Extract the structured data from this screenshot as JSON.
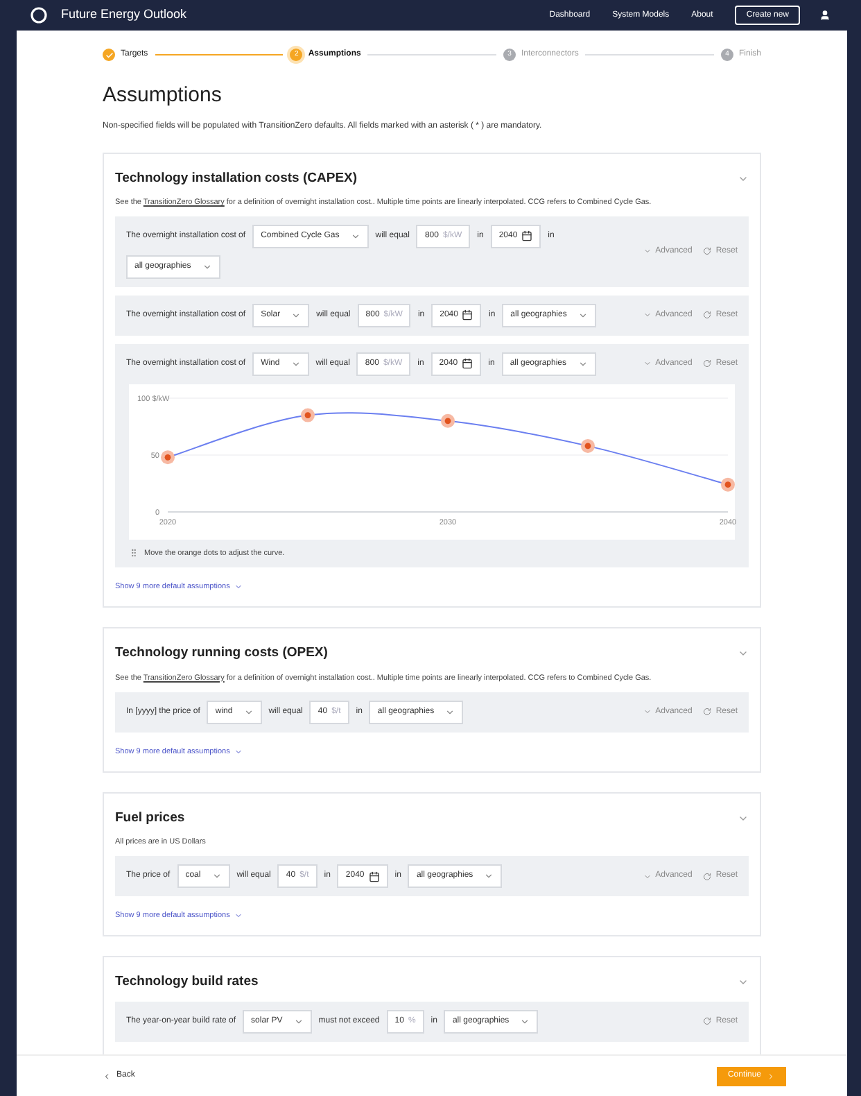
{
  "header": {
    "title": "Future Energy Outlook",
    "nav": [
      {
        "label": "Dashboard"
      },
      {
        "label": "System Models"
      },
      {
        "label": "About"
      }
    ],
    "create_button": "Create new"
  },
  "stepper": [
    {
      "label": "Targets",
      "completed": true,
      "selected": false
    },
    {
      "label": "Assumptions",
      "completed": false,
      "selected": true,
      "number": "2"
    },
    {
      "label": "Interconnectors",
      "completed": false,
      "selected": false,
      "number": "3"
    },
    {
      "label": "Finish",
      "completed": false,
      "selected": false,
      "number": "4"
    }
  ],
  "page": {
    "title": "Assumptions",
    "description": "Non-specified fields will be populated with TransitionZero defaults. All fields marked with an asterisk ( * ) are mandatory."
  },
  "sections": [
    {
      "title": "Technology installation costs (CAPEX)",
      "expanded": true,
      "description": {
        "before": "See the ",
        "link": "TransitionZero Glossary",
        "after": " for a definition of overnight installation cost.. Multiple time points are linearly interpolated. CCG refers to Combined Cycle Gas."
      },
      "rows": [
        {
          "parts": [
            {
              "kind": "text",
              "text": "The overnight installation cost of"
            },
            {
              "kind": "select",
              "value": "Combined Cycle Gas"
            },
            {
              "kind": "text",
              "text": "will equal"
            },
            {
              "kind": "number",
              "value": "800",
              "unit": "$/kW"
            },
            {
              "kind": "text",
              "text": "in"
            },
            {
              "kind": "year",
              "value": "2040"
            },
            {
              "kind": "text",
              "text": "in"
            },
            {
              "kind": "select",
              "value": "all geographies"
            }
          ],
          "advanced": "Advanced",
          "reset": "Reset"
        },
        {
          "parts": [
            {
              "kind": "text",
              "text": "The overnight installation cost of"
            },
            {
              "kind": "select",
              "value": "Solar"
            },
            {
              "kind": "text",
              "text": "will equal"
            },
            {
              "kind": "number",
              "value": "800",
              "unit": "$/kW"
            },
            {
              "kind": "text",
              "text": "in"
            },
            {
              "kind": "year",
              "value": "2040"
            },
            {
              "kind": "text",
              "text": "in"
            },
            {
              "kind": "select",
              "value": "all geographies"
            }
          ],
          "advanced": "Advanced",
          "reset": "Reset"
        },
        {
          "parts": [
            {
              "kind": "text",
              "text": "The overnight installation cost of"
            },
            {
              "kind": "select",
              "value": "Wind"
            },
            {
              "kind": "text",
              "text": "will equal"
            },
            {
              "kind": "number",
              "value": "800",
              "unit": "$/kW"
            },
            {
              "kind": "text",
              "text": "in"
            },
            {
              "kind": "year",
              "value": "2040"
            },
            {
              "kind": "text",
              "text": "in"
            },
            {
              "kind": "select",
              "value": "all geographies"
            }
          ],
          "advanced": "Advanced",
          "reset": "Reset",
          "chart_data": {
            "type": "line",
            "x": [
              2020,
              2025,
              2030,
              2035,
              2040
            ],
            "series": [
              {
                "color": "#6b7ff0",
                "marker": "circle",
                "values": [
                  48,
                  85,
                  80,
                  58,
                  24
                ]
              }
            ],
            "xlim": [
              2020,
              2040
            ],
            "ylim": [
              0,
              100
            ],
            "xticks": [
              2020,
              2030,
              2040
            ],
            "yticks": [
              0,
              50,
              {
                "value": 100,
                "label": "100 $/kW"
              }
            ]
          },
          "hint": "Move the orange dots to adjust the curve."
        }
      ],
      "show_more": "Show 9 more default assumptions"
    },
    {
      "title": "Technology running costs (OPEX)",
      "expanded": true,
      "description": {
        "before": "See the ",
        "link": "TransitionZero Glossary",
        "after": " for a definition of overnight installation cost.. Multiple time points are linearly interpolated. CCG refers to Combined Cycle Gas."
      },
      "rows": [
        {
          "parts": [
            {
              "kind": "text",
              "text": "In [yyyy] the price of"
            },
            {
              "kind": "select",
              "value": "wind"
            },
            {
              "kind": "text",
              "text": "will equal"
            },
            {
              "kind": "number",
              "value": "40",
              "unit": "$/t"
            },
            {
              "kind": "text",
              "text": "in"
            },
            {
              "kind": "select",
              "value": "all geographies"
            }
          ],
          "advanced": "Advanced",
          "reset": "Reset"
        }
      ],
      "show_more": "Show 9 more default assumptions"
    },
    {
      "title": "Fuel prices",
      "expanded": true,
      "description": {
        "before": "All prices are in US Dollars"
      },
      "rows": [
        {
          "parts": [
            {
              "kind": "text",
              "text": "The price of"
            },
            {
              "kind": "select",
              "value": "coal"
            },
            {
              "kind": "text",
              "text": "will equal"
            },
            {
              "kind": "number",
              "value": "40",
              "unit": "$/t"
            },
            {
              "kind": "text",
              "text": "in"
            },
            {
              "kind": "year",
              "value": "2040"
            },
            {
              "kind": "text",
              "text": "in"
            },
            {
              "kind": "select",
              "value": "all geographies"
            }
          ],
          "advanced": "Advanced",
          "reset": "Reset"
        }
      ],
      "show_more": "Show 9 more default assumptions"
    },
    {
      "title": "Technology build rates",
      "expanded": true,
      "rows": [
        {
          "parts": [
            {
              "kind": "text",
              "text": "The year-on-year build rate of"
            },
            {
              "kind": "select",
              "value": "solar PV"
            },
            {
              "kind": "text",
              "text": "must not exceed"
            },
            {
              "kind": "number",
              "value": "10",
              "unit": "%"
            },
            {
              "kind": "text",
              "text": "in"
            },
            {
              "kind": "select",
              "value": "all geographies"
            }
          ],
          "reset": "Reset"
        }
      ]
    }
  ],
  "footer": {
    "back": "Back",
    "continue": "Continue"
  }
}
